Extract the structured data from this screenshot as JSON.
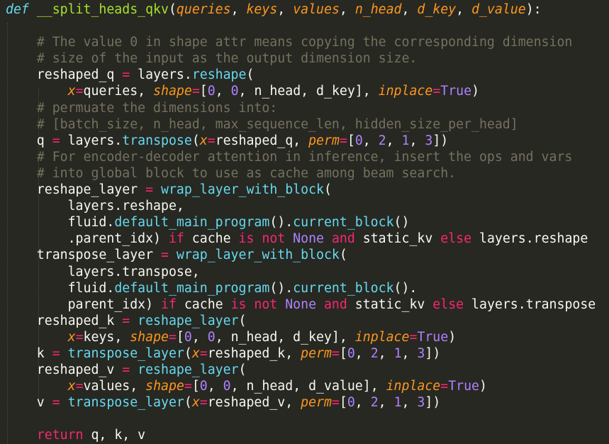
{
  "colors": {
    "background": "#272822",
    "plain": "#f8f8f2",
    "keyword": "#f92672",
    "def": "#66d9ef",
    "function_name": "#a6e22e",
    "parameter": "#fd971f",
    "call": "#66d9ef",
    "kwarg": "#fd971f",
    "operator": "#f92672",
    "number": "#ae81ff",
    "constant": "#ae81ff",
    "comment": "#75715e"
  },
  "code_lines": [
    [
      [
        "def",
        "def"
      ],
      [
        "plain",
        " "
      ],
      [
        "func",
        "__split_heads_qkv"
      ],
      [
        "plain",
        "("
      ],
      [
        "param",
        "queries"
      ],
      [
        "plain",
        ", "
      ],
      [
        "param",
        "keys"
      ],
      [
        "plain",
        ", "
      ],
      [
        "param",
        "values"
      ],
      [
        "plain",
        ", "
      ],
      [
        "param",
        "n_head"
      ],
      [
        "plain",
        ", "
      ],
      [
        "param",
        "d_key"
      ],
      [
        "plain",
        ", "
      ],
      [
        "param",
        "d_value"
      ],
      [
        "plain",
        "):"
      ]
    ],
    [],
    [
      [
        "plain",
        "    "
      ],
      [
        "comment",
        "# The value 0 in shape attr means copying the corresponding dimension"
      ]
    ],
    [
      [
        "plain",
        "    "
      ],
      [
        "comment",
        "# size of the input as the output dimension size."
      ]
    ],
    [
      [
        "plain",
        "    reshaped_q "
      ],
      [
        "op",
        "="
      ],
      [
        "plain",
        " layers."
      ],
      [
        "call",
        "reshape"
      ],
      [
        "plain",
        "("
      ]
    ],
    [
      [
        "plain",
        "        "
      ],
      [
        "kwarg",
        "x"
      ],
      [
        "op",
        "="
      ],
      [
        "plain",
        "queries, "
      ],
      [
        "kwarg",
        "shape"
      ],
      [
        "op",
        "="
      ],
      [
        "plain",
        "["
      ],
      [
        "number",
        "0"
      ],
      [
        "plain",
        ", "
      ],
      [
        "number",
        "0"
      ],
      [
        "plain",
        ", n_head, d_key], "
      ],
      [
        "kwarg",
        "inplace"
      ],
      [
        "op",
        "="
      ],
      [
        "const",
        "True"
      ],
      [
        "plain",
        ")"
      ]
    ],
    [
      [
        "plain",
        "    "
      ],
      [
        "comment",
        "# permuate the dimensions into:"
      ]
    ],
    [
      [
        "plain",
        "    "
      ],
      [
        "comment",
        "# [batch_size, n_head, max_sequence_len, hidden_size_per_head]"
      ]
    ],
    [
      [
        "plain",
        "    q "
      ],
      [
        "op",
        "="
      ],
      [
        "plain",
        " layers."
      ],
      [
        "call",
        "transpose"
      ],
      [
        "plain",
        "("
      ],
      [
        "kwarg",
        "x"
      ],
      [
        "op",
        "="
      ],
      [
        "plain",
        "reshaped_q, "
      ],
      [
        "kwarg",
        "perm"
      ],
      [
        "op",
        "="
      ],
      [
        "plain",
        "["
      ],
      [
        "number",
        "0"
      ],
      [
        "plain",
        ", "
      ],
      [
        "number",
        "2"
      ],
      [
        "plain",
        ", "
      ],
      [
        "number",
        "1"
      ],
      [
        "plain",
        ", "
      ],
      [
        "number",
        "3"
      ],
      [
        "plain",
        "])"
      ]
    ],
    [
      [
        "plain",
        "    "
      ],
      [
        "comment",
        "# For encoder-decoder attention in inference, insert the ops and vars"
      ]
    ],
    [
      [
        "plain",
        "    "
      ],
      [
        "comment",
        "# into global block to use as cache among beam search."
      ]
    ],
    [
      [
        "plain",
        "    reshape_layer "
      ],
      [
        "op",
        "="
      ],
      [
        "plain",
        " "
      ],
      [
        "call",
        "wrap_layer_with_block"
      ],
      [
        "plain",
        "("
      ]
    ],
    [
      [
        "plain",
        "        layers.reshape,"
      ]
    ],
    [
      [
        "plain",
        "        fluid."
      ],
      [
        "call",
        "default_main_program"
      ],
      [
        "plain",
        "()."
      ],
      [
        "call",
        "current_block"
      ],
      [
        "plain",
        "()"
      ]
    ],
    [
      [
        "plain",
        "        .parent_idx) "
      ],
      [
        "keyword",
        "if"
      ],
      [
        "plain",
        " cache "
      ],
      [
        "keyword",
        "is not"
      ],
      [
        "plain",
        " "
      ],
      [
        "const",
        "None"
      ],
      [
        "plain",
        " "
      ],
      [
        "keyword",
        "and"
      ],
      [
        "plain",
        " static_kv "
      ],
      [
        "keyword",
        "else"
      ],
      [
        "plain",
        " layers.reshape"
      ]
    ],
    [
      [
        "plain",
        "    transpose_layer "
      ],
      [
        "op",
        "="
      ],
      [
        "plain",
        " "
      ],
      [
        "call",
        "wrap_layer_with_block"
      ],
      [
        "plain",
        "("
      ]
    ],
    [
      [
        "plain",
        "        layers.transpose,"
      ]
    ],
    [
      [
        "plain",
        "        fluid."
      ],
      [
        "call",
        "default_main_program"
      ],
      [
        "plain",
        "()."
      ],
      [
        "call",
        "current_block"
      ],
      [
        "plain",
        "()."
      ]
    ],
    [
      [
        "plain",
        "        parent_idx) "
      ],
      [
        "keyword",
        "if"
      ],
      [
        "plain",
        " cache "
      ],
      [
        "keyword",
        "is not"
      ],
      [
        "plain",
        " "
      ],
      [
        "const",
        "None"
      ],
      [
        "plain",
        " "
      ],
      [
        "keyword",
        "and"
      ],
      [
        "plain",
        " static_kv "
      ],
      [
        "keyword",
        "else"
      ],
      [
        "plain",
        " layers.transpose"
      ]
    ],
    [
      [
        "plain",
        "    reshaped_k "
      ],
      [
        "op",
        "="
      ],
      [
        "plain",
        " "
      ],
      [
        "call",
        "reshape_layer"
      ],
      [
        "plain",
        "("
      ]
    ],
    [
      [
        "plain",
        "        "
      ],
      [
        "kwarg",
        "x"
      ],
      [
        "op",
        "="
      ],
      [
        "plain",
        "keys, "
      ],
      [
        "kwarg",
        "shape"
      ],
      [
        "op",
        "="
      ],
      [
        "plain",
        "["
      ],
      [
        "number",
        "0"
      ],
      [
        "plain",
        ", "
      ],
      [
        "number",
        "0"
      ],
      [
        "plain",
        ", n_head, d_key], "
      ],
      [
        "kwarg",
        "inplace"
      ],
      [
        "op",
        "="
      ],
      [
        "const",
        "True"
      ],
      [
        "plain",
        ")"
      ]
    ],
    [
      [
        "plain",
        "    k "
      ],
      [
        "op",
        "="
      ],
      [
        "plain",
        " "
      ],
      [
        "call",
        "transpose_layer"
      ],
      [
        "plain",
        "("
      ],
      [
        "kwarg",
        "x"
      ],
      [
        "op",
        "="
      ],
      [
        "plain",
        "reshaped_k, "
      ],
      [
        "kwarg",
        "perm"
      ],
      [
        "op",
        "="
      ],
      [
        "plain",
        "["
      ],
      [
        "number",
        "0"
      ],
      [
        "plain",
        ", "
      ],
      [
        "number",
        "2"
      ],
      [
        "plain",
        ", "
      ],
      [
        "number",
        "1"
      ],
      [
        "plain",
        ", "
      ],
      [
        "number",
        "3"
      ],
      [
        "plain",
        "])"
      ]
    ],
    [
      [
        "plain",
        "    reshaped_v "
      ],
      [
        "op",
        "="
      ],
      [
        "plain",
        " "
      ],
      [
        "call",
        "reshape_layer"
      ],
      [
        "plain",
        "("
      ]
    ],
    [
      [
        "plain",
        "        "
      ],
      [
        "kwarg",
        "x"
      ],
      [
        "op",
        "="
      ],
      [
        "plain",
        "values, "
      ],
      [
        "kwarg",
        "shape"
      ],
      [
        "op",
        "="
      ],
      [
        "plain",
        "["
      ],
      [
        "number",
        "0"
      ],
      [
        "plain",
        ", "
      ],
      [
        "number",
        "0"
      ],
      [
        "plain",
        ", n_head, d_value], "
      ],
      [
        "kwarg",
        "inplace"
      ],
      [
        "op",
        "="
      ],
      [
        "const",
        "True"
      ],
      [
        "plain",
        ")"
      ]
    ],
    [
      [
        "plain",
        "    v "
      ],
      [
        "op",
        "="
      ],
      [
        "plain",
        " "
      ],
      [
        "call",
        "transpose_layer"
      ],
      [
        "plain",
        "("
      ],
      [
        "kwarg",
        "x"
      ],
      [
        "op",
        "="
      ],
      [
        "plain",
        "reshaped_v, "
      ],
      [
        "kwarg",
        "perm"
      ],
      [
        "op",
        "="
      ],
      [
        "plain",
        "["
      ],
      [
        "number",
        "0"
      ],
      [
        "plain",
        ", "
      ],
      [
        "number",
        "2"
      ],
      [
        "plain",
        ", "
      ],
      [
        "number",
        "1"
      ],
      [
        "plain",
        ", "
      ],
      [
        "number",
        "3"
      ],
      [
        "plain",
        "])"
      ]
    ],
    [],
    [
      [
        "plain",
        "    "
      ],
      [
        "keyword",
        "return"
      ],
      [
        "plain",
        " q, k, v"
      ]
    ]
  ]
}
